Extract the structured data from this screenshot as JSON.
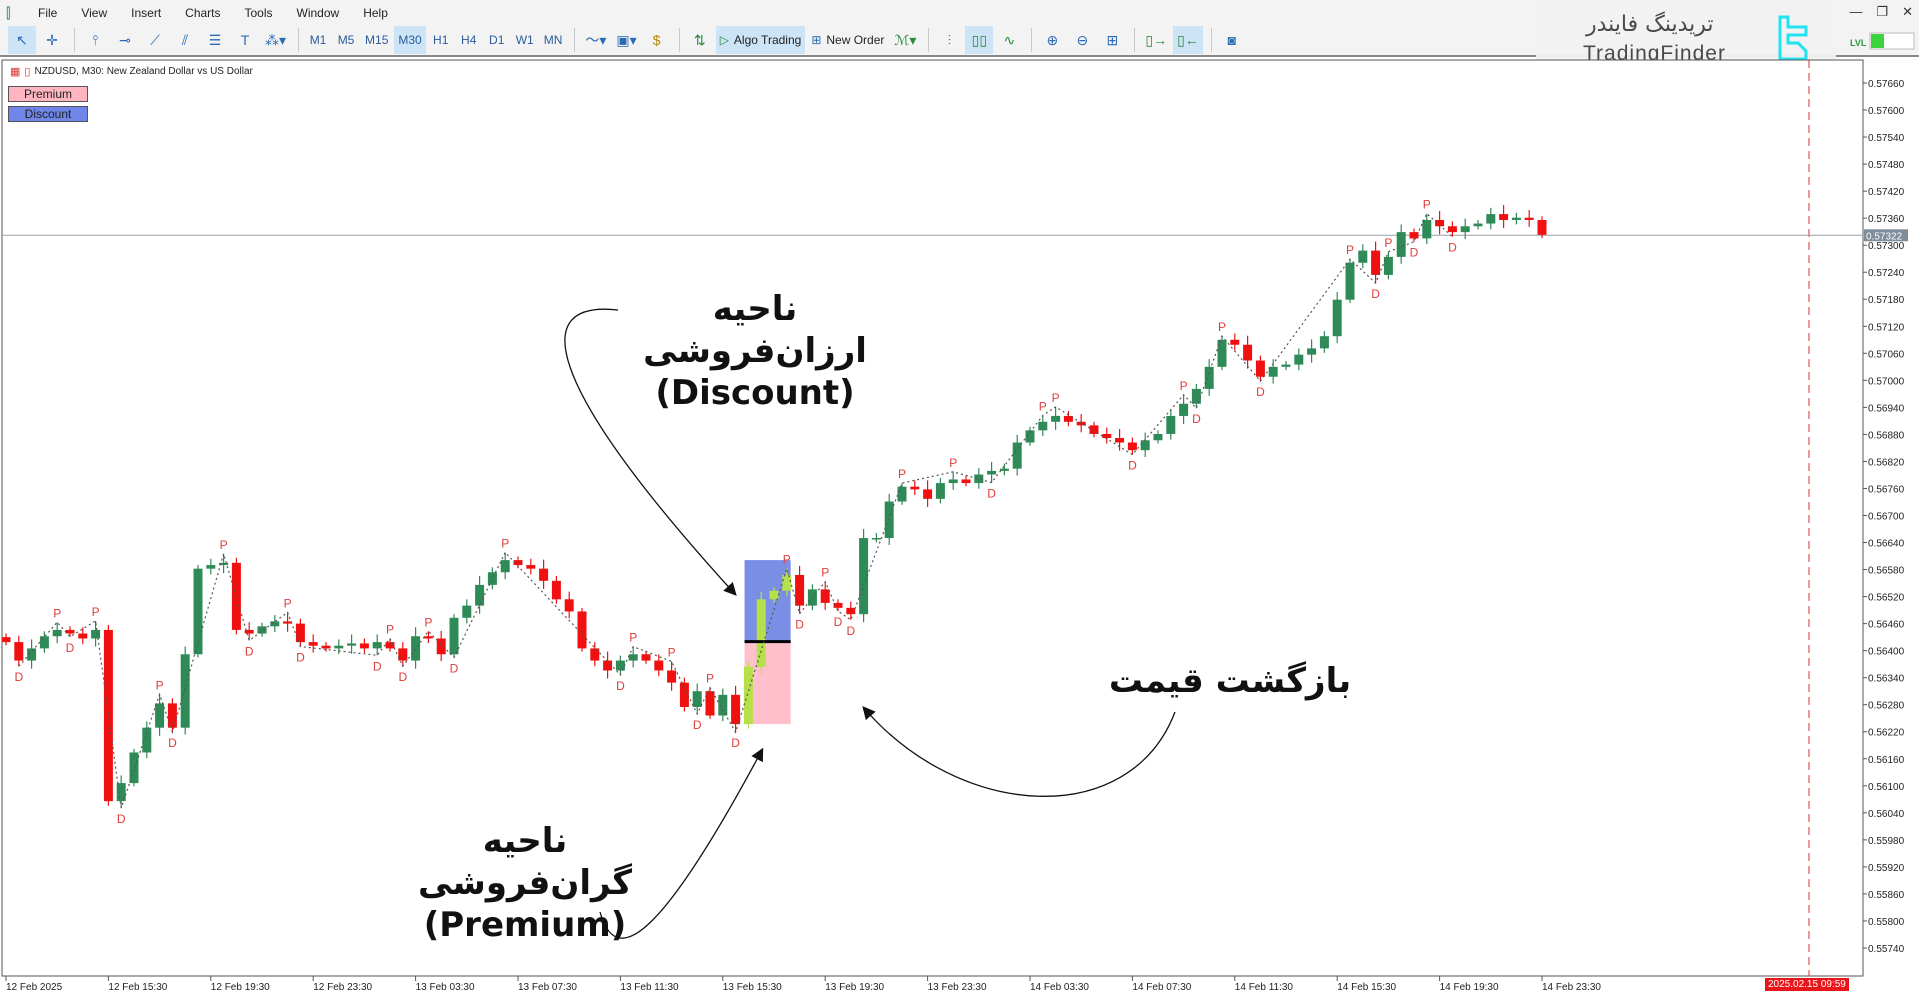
{
  "menu": {
    "items": [
      "File",
      "View",
      "Insert",
      "Charts",
      "Tools",
      "Window",
      "Help"
    ]
  },
  "toolbar": {
    "timeframes": [
      "M1",
      "M5",
      "M15",
      "M30",
      "H1",
      "H4",
      "D1",
      "W1",
      "MN"
    ],
    "active_timeframe": "M30",
    "algo_trading": "Algo Trading",
    "new_order": "New Order"
  },
  "watermark": {
    "fa": "تریدینگ فایندر",
    "en": "TradingFinder"
  },
  "chart": {
    "title": "NZDUSD, M30:  New Zealand Dollar vs US Dollar",
    "premium_label": "Premium",
    "discount_label": "Discount",
    "server_time": "2025.02.15 09:59"
  },
  "annotations": {
    "discount_fa": "ناحیه ارزان‌فروشی",
    "discount_en": "(Discount)",
    "premium_fa": "ناحیه گران‌فروشی",
    "premium_en": "(Premium)",
    "return_fa": "بازگشت قیمت"
  },
  "colors": {
    "bull": "#2e8b57",
    "bear": "#f01010",
    "highlight": "#b5e04a",
    "premium_zone": "#ffc0cb",
    "discount_zone": "#7b8ee6",
    "pivot": "#e03c3c",
    "current_price_badge": "#7f8c99"
  },
  "chart_data": {
    "type": "candlestick",
    "symbol": "NZDUSD",
    "timeframe": "M30",
    "ylim": [
      0.5571,
      0.5769
    ],
    "yticks": [
      0.5574,
      0.558,
      0.5586,
      0.5592,
      0.5598,
      0.5604,
      0.561,
      0.5616,
      0.5622,
      0.5628,
      0.5634,
      0.564,
      0.5646,
      0.5652,
      0.5658,
      0.5664,
      0.567,
      0.5676,
      0.5682,
      0.5688,
      0.5694,
      0.57,
      0.5706,
      0.5712,
      0.5718,
      0.5724,
      0.573,
      0.5736,
      0.5742,
      0.5748,
      0.5754,
      0.576,
      0.5766
    ],
    "xticks": [
      {
        "i": 0,
        "label": "12 Feb 2025"
      },
      {
        "i": 8,
        "label": "12 Feb 15:30"
      },
      {
        "i": 16,
        "label": "12 Feb 19:30"
      },
      {
        "i": 24,
        "label": "12 Feb 23:30"
      },
      {
        "i": 32,
        "label": "13 Feb 03:30"
      },
      {
        "i": 40,
        "label": "13 Feb 07:30"
      },
      {
        "i": 48,
        "label": "13 Feb 11:30"
      },
      {
        "i": 56,
        "label": "13 Feb 15:30"
      },
      {
        "i": 64,
        "label": "13 Feb 19:30"
      },
      {
        "i": 72,
        "label": "13 Feb 23:30"
      },
      {
        "i": 80,
        "label": "14 Feb 03:30"
      },
      {
        "i": 88,
        "label": "14 Feb 07:30"
      },
      {
        "i": 96,
        "label": "14 Feb 11:30"
      },
      {
        "i": 104,
        "label": "14 Feb 15:30"
      },
      {
        "i": 112,
        "label": "14 Feb 19:30"
      },
      {
        "i": 120,
        "label": "14 Feb 23:30"
      }
    ],
    "first_open": 0.5643,
    "closes": [
      0.56419,
      0.56378,
      0.56405,
      0.56432,
      0.56446,
      0.56438,
      0.56427,
      0.56446,
      0.56066,
      0.56106,
      0.56174,
      0.56229,
      0.56283,
      0.56229,
      0.56392,
      0.56582,
      0.5659,
      0.56595,
      0.56446,
      0.56438,
      0.56454,
      0.56465,
      0.5646,
      0.56419,
      0.56411,
      0.56405,
      0.56411,
      0.56416,
      0.56405,
      0.56419,
      0.56405,
      0.56378,
      0.56432,
      0.56427,
      0.56392,
      0.56473,
      0.565,
      0.56546,
      0.56574,
      0.56601,
      0.5659,
      0.56582,
      0.56555,
      0.56514,
      0.56487,
      0.56405,
      0.56378,
      0.56356,
      0.56378,
      0.56392,
      0.56378,
      0.56356,
      0.56329,
      0.56275,
      0.5631,
      0.56256,
      0.56302,
      0.56237,
      0.56364,
      0.56514,
      0.56533,
      0.56568,
      0.565,
      0.56536,
      0.56506,
      0.56495,
      0.56481,
      0.5665,
      0.5665,
      0.56731,
      0.56764,
      0.56758,
      0.56737,
      0.56772,
      0.5678,
      0.56772,
      0.56791,
      0.56799,
      0.56804,
      0.56862,
      0.56889,
      0.56908,
      0.56921,
      0.56908,
      0.569,
      0.56881,
      0.56872,
      0.56862,
      0.56845,
      0.56867,
      0.56881,
      0.56921,
      0.56948,
      0.56981,
      0.5703,
      0.5709,
      0.57079,
      0.57044,
      0.57008,
      0.5703,
      0.57035,
      0.57057,
      0.57071,
      0.57098,
      0.57179,
      0.57261,
      0.57288,
      0.57234,
      0.57274,
      0.57329,
      0.57315,
      0.57356,
      0.57342,
      0.57329,
      0.57342,
      0.57348,
      0.57369,
      0.57356,
      0.57361,
      0.57356,
      0.57323
    ],
    "pivots": [
      [
        1,
        "D"
      ],
      [
        4,
        "P"
      ],
      [
        5,
        "D"
      ],
      [
        7,
        "P"
      ],
      [
        9,
        "D"
      ],
      [
        12,
        "P"
      ],
      [
        13,
        "D"
      ],
      [
        17,
        "P"
      ],
      [
        19,
        "D"
      ],
      [
        22,
        "P"
      ],
      [
        23,
        "D"
      ],
      [
        29,
        "D"
      ],
      [
        30,
        "P"
      ],
      [
        31,
        "D"
      ],
      [
        33,
        "P"
      ],
      [
        35,
        "D"
      ],
      [
        39,
        "P"
      ],
      [
        48,
        "D"
      ],
      [
        49,
        "P"
      ],
      [
        52,
        "P"
      ],
      [
        54,
        "D"
      ],
      [
        55,
        "P"
      ],
      [
        57,
        "D"
      ],
      [
        61,
        "P"
      ],
      [
        62,
        "D"
      ],
      [
        64,
        "P"
      ],
      [
        65,
        "D"
      ],
      [
        66,
        "D"
      ],
      [
        70,
        "P"
      ],
      [
        74,
        "P"
      ],
      [
        77,
        "D"
      ],
      [
        81,
        "P"
      ],
      [
        82,
        "P"
      ],
      [
        88,
        "D"
      ],
      [
        92,
        "P"
      ],
      [
        93,
        "D"
      ],
      [
        95,
        "P"
      ],
      [
        98,
        "D"
      ],
      [
        105,
        "P"
      ],
      [
        107,
        "D"
      ],
      [
        108,
        "P"
      ],
      [
        110,
        "D"
      ],
      [
        111,
        "P"
      ],
      [
        113,
        "D"
      ]
    ],
    "current_price": 0.57322,
    "premium_zone": [
      0.56237,
      0.5642
    ],
    "discount_zone": [
      0.5642,
      0.56601
    ],
    "zone_equilibrium": 0.5642
  }
}
